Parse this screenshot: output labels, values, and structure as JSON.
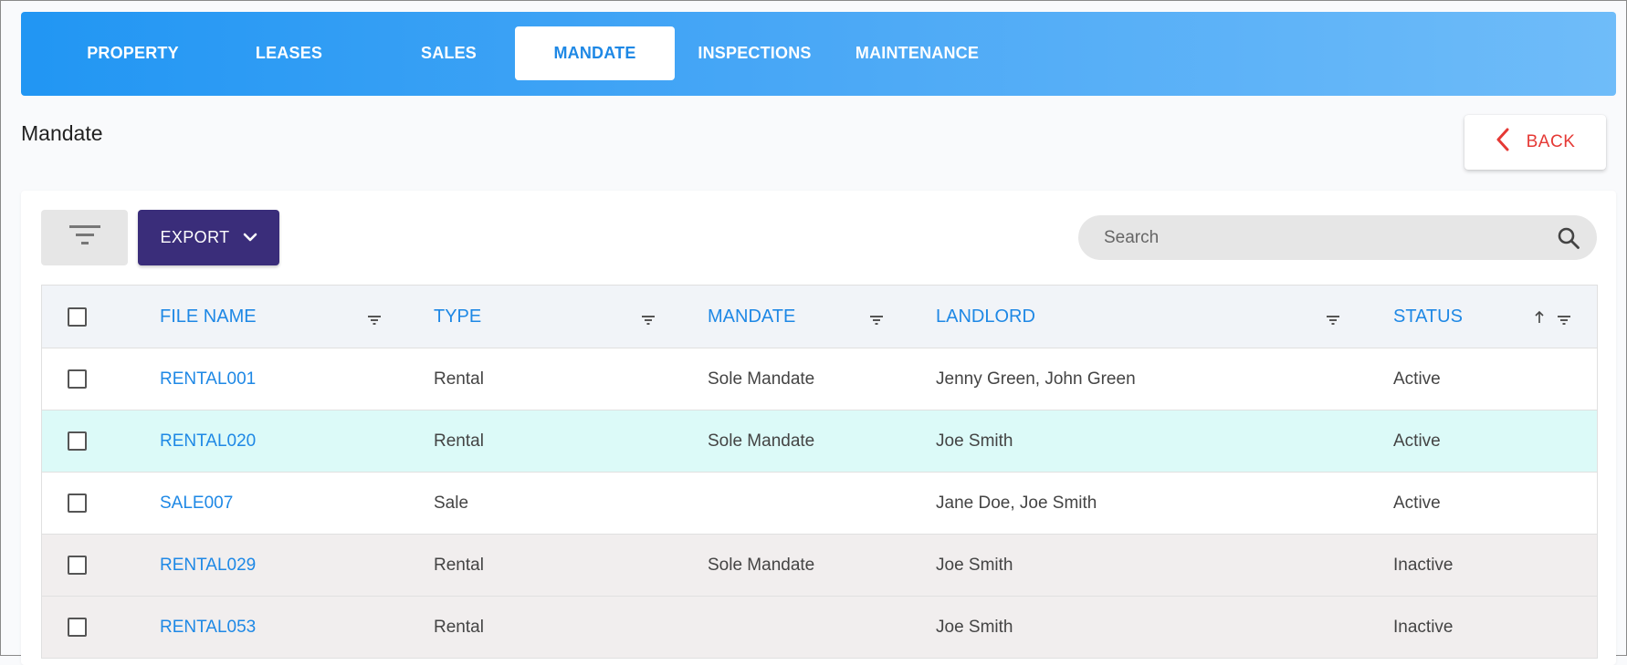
{
  "nav": {
    "tabs": [
      {
        "label": "PROPERTY"
      },
      {
        "label": "LEASES"
      },
      {
        "label": "SALES"
      },
      {
        "label": "MANDATE"
      },
      {
        "label": "INSPECTIONS"
      },
      {
        "label": "MAINTENANCE"
      }
    ],
    "active_tab": "MANDATE"
  },
  "page": {
    "title": "Mandate",
    "back_label": "BACK"
  },
  "toolbar": {
    "filter_icon": "filter-lines-icon",
    "export_label": "EXPORT",
    "export_icon": "chevron-down-icon"
  },
  "search": {
    "placeholder": "Search",
    "icon": "search-icon"
  },
  "table": {
    "columns": {
      "file_name": "FILE NAME",
      "type": "TYPE",
      "mandate": "MANDATE",
      "landlord": "LANDLORD",
      "status": "STATUS"
    },
    "sort": {
      "column": "STATUS",
      "direction": "ascending"
    },
    "rows": [
      {
        "file_name": "RENTAL001",
        "type": "Rental",
        "mandate": "Sole Mandate",
        "landlord": "Jenny Green, John Green",
        "status": "Active"
      },
      {
        "file_name": "RENTAL020",
        "type": "Rental",
        "mandate": "Sole Mandate",
        "landlord": "Joe Smith",
        "status": "Active"
      },
      {
        "file_name": "SALE007",
        "type": "Sale",
        "mandate": "",
        "landlord": "Jane Doe, Joe Smith",
        "status": "Active"
      },
      {
        "file_name": "RENTAL029",
        "type": "Rental",
        "mandate": "Sole Mandate",
        "landlord": "Joe Smith",
        "status": "Inactive"
      },
      {
        "file_name": "RENTAL053",
        "type": "Rental",
        "mandate": "",
        "landlord": "Joe Smith",
        "status": "Inactive"
      }
    ]
  },
  "colors": {
    "accent_blue": "#1e88e5",
    "export_purple": "#3a2d7a",
    "back_red": "#e53935",
    "highlight_row": "#dcfaf8",
    "inactive_row": "#f1eeee"
  }
}
